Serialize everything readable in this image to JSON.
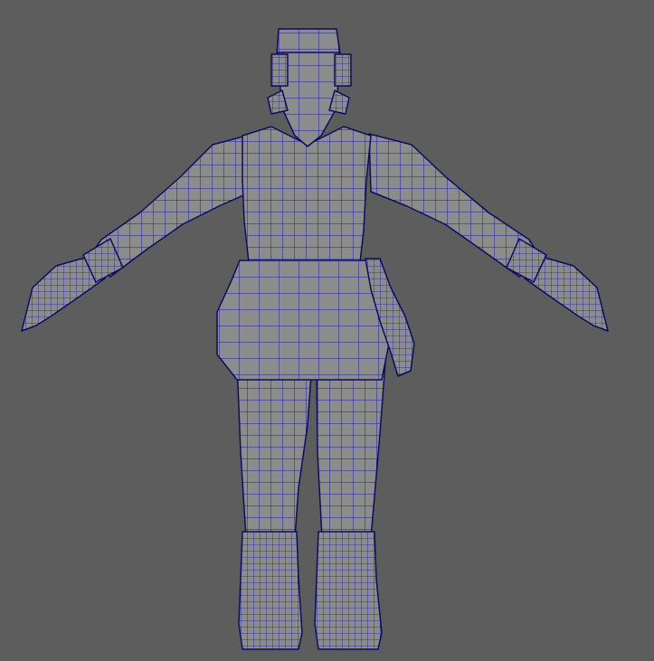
{
  "viewport": {
    "background_color": "#5d5d5d",
    "model_fill_color": "#8c8c8c",
    "wireframe_color": "#1c1ca8",
    "outline_color": "#0d0d60"
  },
  "model": {
    "parts": [
      "helmet",
      "ear-pieces",
      "torso",
      "left-arm",
      "right-arm",
      "left-hand",
      "right-hand",
      "pelvis",
      "left-leg",
      "right-leg",
      "left-boot",
      "right-boot",
      "chain"
    ]
  }
}
